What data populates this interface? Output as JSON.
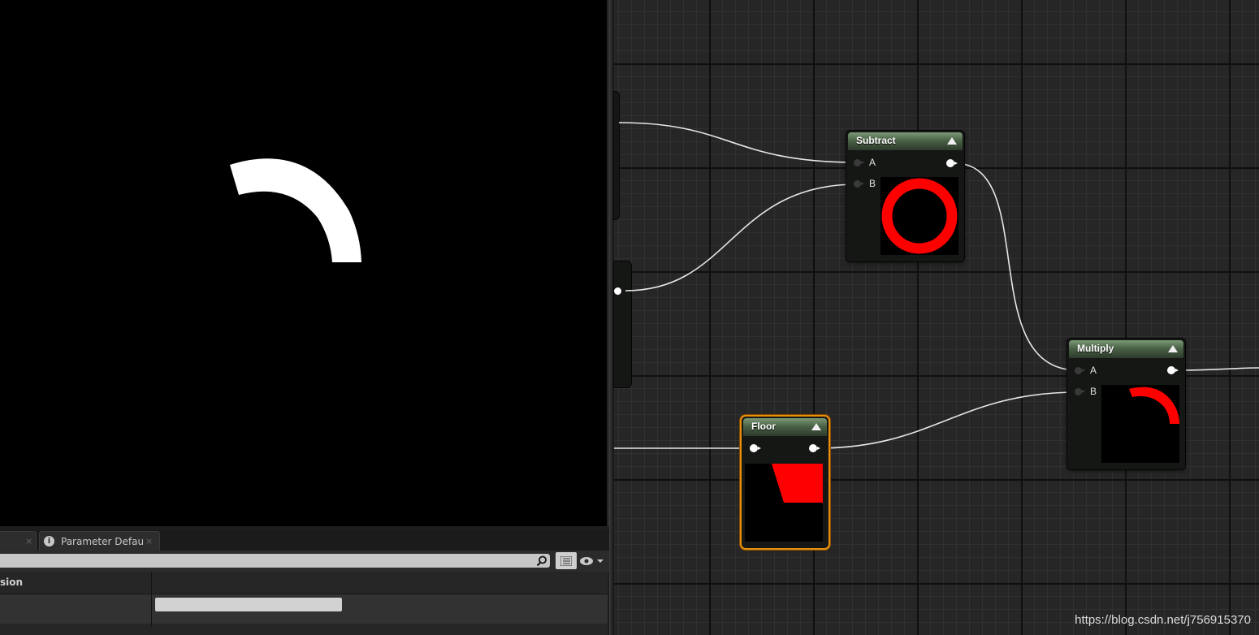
{
  "bottom_panel": {
    "tabs": [
      {
        "label": "",
        "close": "×"
      },
      {
        "label": "Parameter Defaults",
        "close": "×"
      }
    ],
    "search": {
      "placeholder": "",
      "value": ""
    },
    "details": {
      "header_label": "sion"
    }
  },
  "graph": {
    "nodes": {
      "subtract": {
        "title": "Subtract",
        "pins": {
          "a": "A",
          "b": "B"
        }
      },
      "multiply": {
        "title": "Multiply",
        "pins": {
          "a": "A",
          "b": "B"
        }
      },
      "floor": {
        "title": "Floor"
      }
    }
  },
  "colors": {
    "preview_accent": "#ff0000",
    "selection": "#e8900e",
    "node_header": "#4a6246"
  },
  "watermark": "https://blog.csdn.net/j756915370"
}
